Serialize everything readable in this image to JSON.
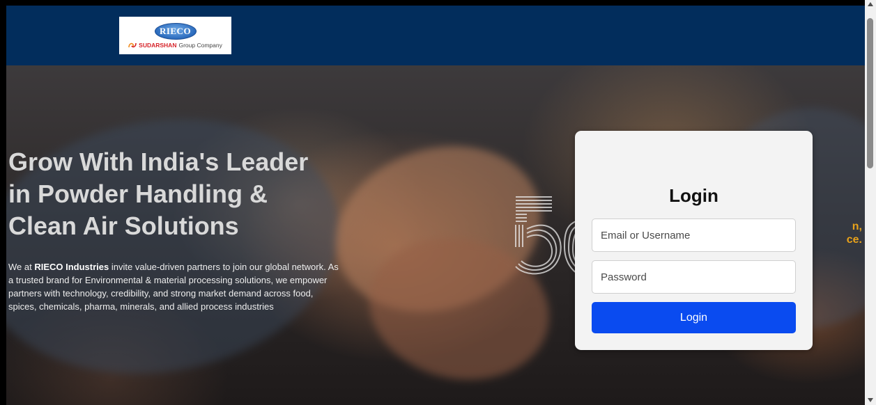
{
  "header": {
    "logo": {
      "mark_text": "RIECO",
      "brand_text": "SUDARSHAN",
      "group_text": "Group Company"
    }
  },
  "hero": {
    "title_line1": "Grow With India's Leader",
    "title_line2": "in Powder Handling &",
    "title_line3": "Clean Air Solutions",
    "text_prefix": "We at ",
    "text_company": "RIECO Industries",
    "text_rest": " invite value-driven partners to join our global network. As a trusted brand for Environmental & material processing solutions, we empower partners with technology, credibility, and strong market demand across food, spices, chemicals, pharma, minerals, and allied process industries",
    "right_snippet_line1": "n,",
    "right_snippet_line2": "ce."
  },
  "login": {
    "title": "Login",
    "username_placeholder": "Email or Username",
    "password_placeholder": "Password",
    "button_label": "Login"
  },
  "colors": {
    "header_bg": "#022d5c",
    "button_bg": "#0a4bf0",
    "accent_orange": "#e8a21a"
  }
}
